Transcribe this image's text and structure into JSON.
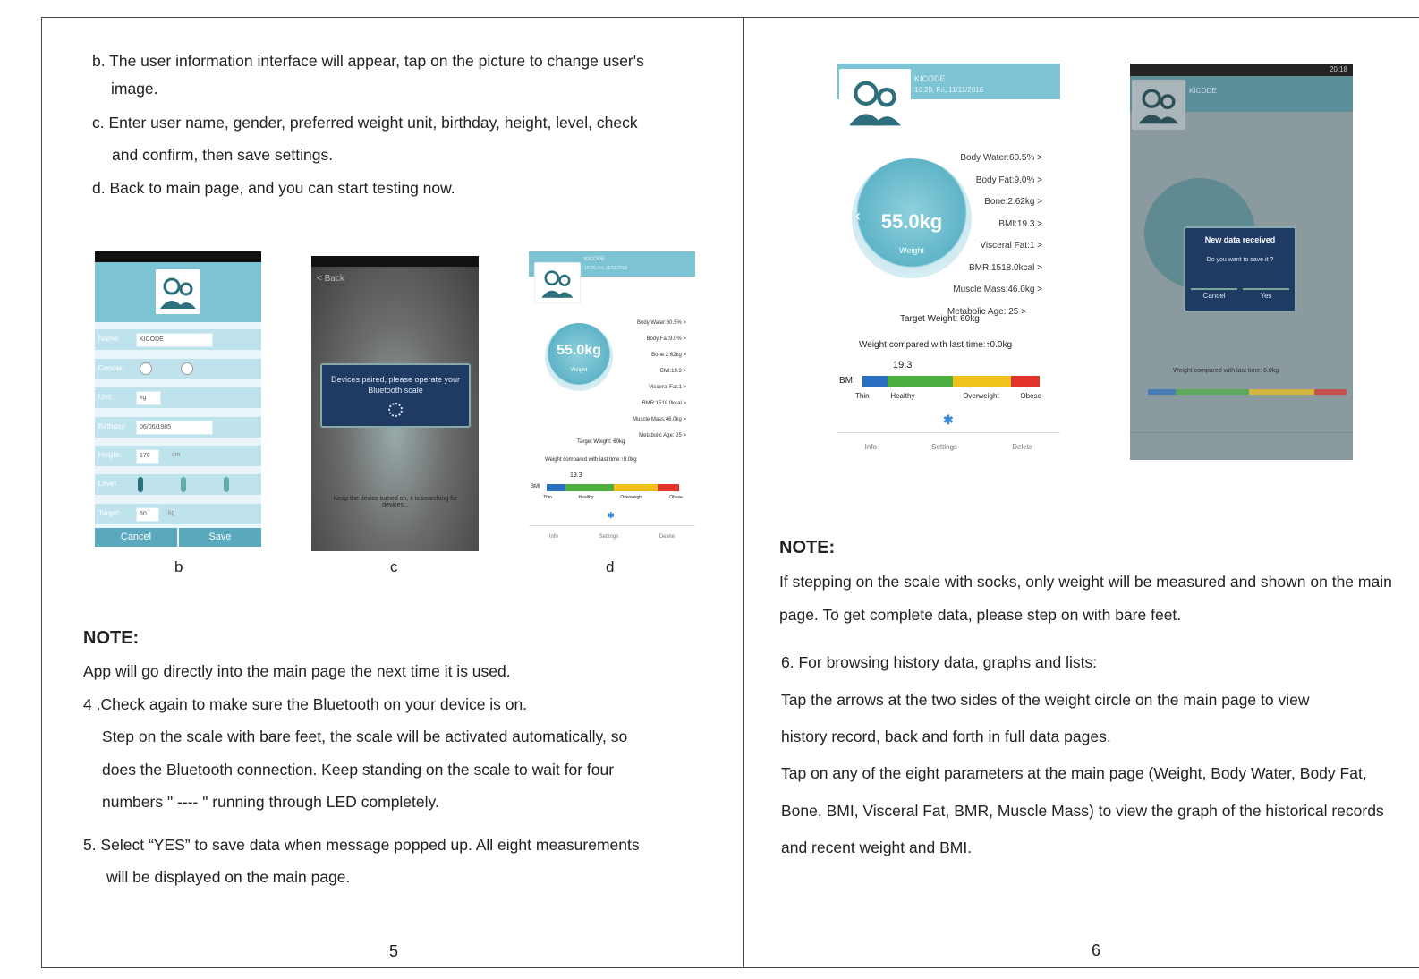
{
  "page5": {
    "lines": {
      "b1": "b. The user information interface will appear, tap on the picture to change user's",
      "b2": "image.",
      "c1": "c. Enter user name, gender, preferred weight unit, birthday, height, level, check",
      "c2": "and confirm, then save settings.",
      "d1": "d. Back to main page, and you can start testing now."
    },
    "captions": {
      "b": "b",
      "c": "c",
      "d": "d"
    },
    "note_title": "NOTE:",
    "note_lines": [
      "App will go directly into the main page the next time it is used.",
      "4 .Check again to make sure the Bluetooth on your device is on.",
      "Step on the scale with bare feet, the scale will be activated automatically, so",
      "does the Bluetooth connection. Keep standing on the scale to wait for four",
      "numbers \" ---- \" running through LED completely.",
      "5. Select “YES” to save data when message popped up. All eight measurements",
      "will be displayed on the main page."
    ],
    "page_number": "5"
  },
  "screen_b": {
    "rows": [
      "Name:",
      "Gender:",
      "Unit:",
      "Birthday:",
      "Height:",
      "Level:",
      "Target:"
    ],
    "name_value": "KICODE",
    "unit_value": "kg",
    "birthday_value": "06/06/1985",
    "height_value": "170",
    "height_unit": "cm",
    "target_value": "60",
    "target_unit": "kg",
    "cancel": "Cancel",
    "save": "Save"
  },
  "screen_c": {
    "back": "< Back",
    "dialog": "Devices paired, please operate your Bluetooth scale",
    "bottom": "Keep the device turned on, it is searching for devices..."
  },
  "screen_main": {
    "user": "KICODE",
    "date": "10:20, Fri, 11/11/2016",
    "weight": "55.0kg",
    "weight_label": "Weight",
    "metrics": [
      "Body Water:60.5% >",
      "Body Fat:9.0% >",
      "Bone:2.62kg >",
      "BMI:19.3 >",
      "Visceral Fat:1 >",
      "BMR:1518.0kcal >",
      "Muscle Mass:46.0kg >",
      "Metabolic Age: 25 >"
    ],
    "target": "Target Weight: 60kg",
    "compare": "Weight compared with last time:↑0.0kg",
    "bmi_value": "19.3",
    "bmi_label": "BMI",
    "bmi_scale": [
      "Thin",
      "Healthy",
      "Overweight",
      "Obese"
    ],
    "bmi_colors": [
      "#2a6fc0",
      "#4caf3f",
      "#f2c21c",
      "#e0332c"
    ],
    "bluetooth": "✱",
    "footer": [
      "Info",
      "Settings",
      "Delete"
    ]
  },
  "screen_dialog": {
    "statusbar": "20:18",
    "user": "KICODE",
    "title": "New data received",
    "message": "Do you want to save it ?",
    "cancel": "Cancel",
    "yes": "Yes",
    "compare": "Weight compared with last time: 0.0kg"
  },
  "page6": {
    "note_title": "NOTE:",
    "note_line1": "If stepping on the scale with socks, only weight will be measured and shown on the main",
    "note_line2": "page. To get complete data, please step on with bare feet.",
    "lines": [
      "6. For browsing history data, graphs and lists:",
      "Tap the arrows at the two sides of the weight circle on the main page to view",
      "history record, back and forth in full data pages.",
      "Tap on any of the eight parameters at the main page (Weight, Body Water, Body Fat,",
      "Bone, BMI, Visceral Fat, BMR, Muscle Mass) to view the graph of the historical records",
      "and recent weight and BMI."
    ],
    "page_number": "6"
  }
}
